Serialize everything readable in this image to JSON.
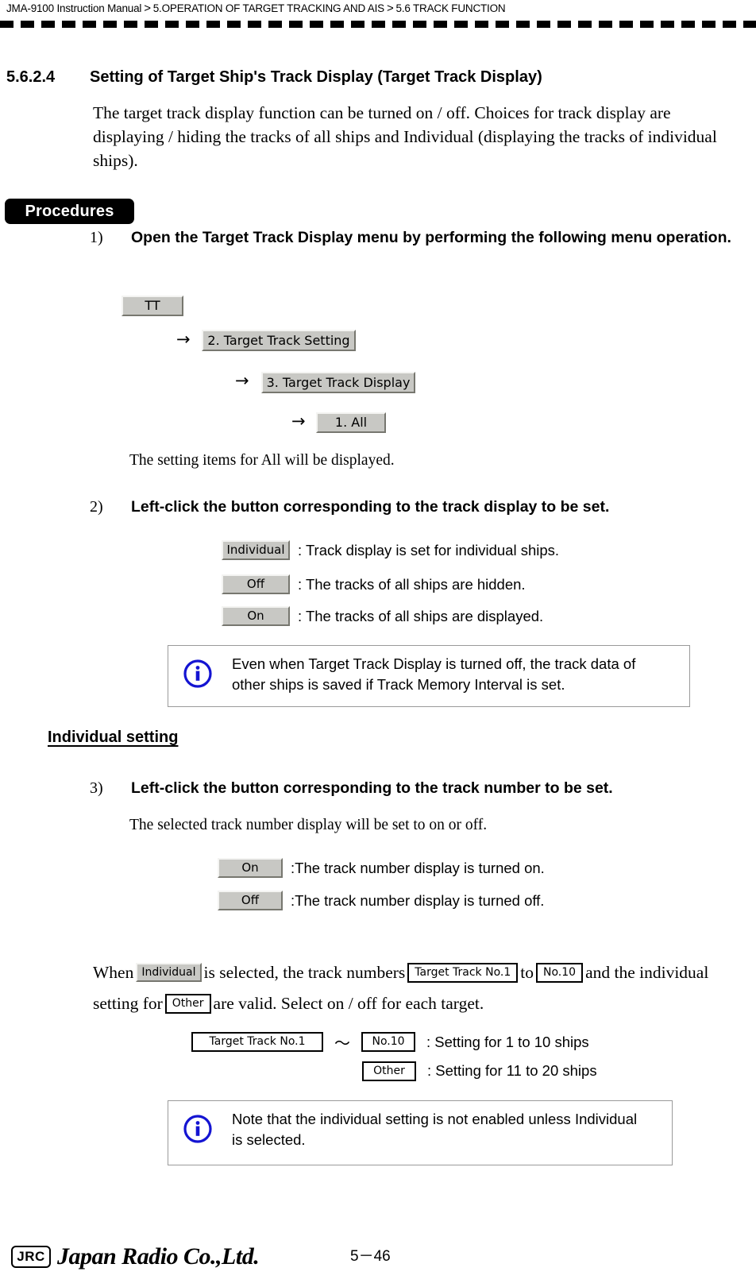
{
  "header": {
    "manual": "JMA-9100 Instruction Manual",
    "sep": ">",
    "chapter": "5.OPERATION OF TARGET TRACKING AND AIS",
    "section": "5.6  TRACK FUNCTION"
  },
  "section": {
    "number": "5.6.2.4",
    "title": "Setting of Target Ship's Track Display (Target Track Display)",
    "intro": "The target track display function can be turned on / off. Choices for track display are displaying / hiding the tracks of all ships and Individual (displaying the tracks of individual ships)."
  },
  "procedures": {
    "badge": "Procedures",
    "step1": {
      "num": "1)",
      "text": "Open the Target Track Display menu by performing the following menu operation."
    },
    "step2": {
      "num": "2)",
      "text": "Left-click the button corresponding to the track display to be set."
    },
    "step3": {
      "num": "3)",
      "text": "Left-click the button corresponding to the track number to be set."
    }
  },
  "menu_chain": {
    "arrow": "→",
    "btn_tt": "TT",
    "btn_target_track_setting": "2. Target Track Setting",
    "btn_target_track_display": "3. Target Track Display",
    "btn_all": "1. All",
    "result_text": "The setting items for All will be displayed."
  },
  "display_choices": [
    {
      "button": "Individual",
      "desc": ": Track display is set for individual ships."
    },
    {
      "button": "Off",
      "desc": ": The tracks of all ships are hidden."
    },
    {
      "button": "On",
      "desc": ": The tracks of all ships are displayed."
    }
  ],
  "note1": {
    "icon": "info-icon",
    "line1": "Even when Target Track Display is turned off, the track data of",
    "line2": "other ships is saved if Track Memory Interval is set."
  },
  "individual_setting": {
    "heading": "Individual setting",
    "selected_text": "The selected track number display will be set to on or off.",
    "choices": [
      {
        "button": "On",
        "desc": ":The track number display is turned on."
      },
      {
        "button": "Off",
        "desc": ":The track number display is turned off."
      }
    ]
  },
  "when_para": {
    "p1": "When",
    "btn_individual": "Individual",
    "p2": "is selected, the track numbers",
    "box_target_track_no1": "Target Track No.1",
    "p3": "to",
    "box_no10": "No.10",
    "p4": "and the individual setting for",
    "box_other": "Other",
    "p5": "are valid. Select on / off for each target."
  },
  "range_legend": [
    {
      "box_a": "Target Track No.1",
      "tilde": "～",
      "box_b": "No.10",
      "desc": ": Setting for 1 to 10 ships"
    },
    {
      "box_c": "Other",
      "desc": ": Setting for 11 to 20 ships"
    }
  ],
  "note2": {
    "icon": "info-icon",
    "line1": "Note that the individual setting is not enabled unless  Individual",
    "line2": "is selected."
  },
  "footer": {
    "logo": "JRC",
    "company": "Japan Radio Co.,Ltd.",
    "page": "5－46"
  },
  "colors": {
    "info_blue": "#1414d2",
    "button_face": "#c8c8c4",
    "note_border": "#9a9a9a"
  }
}
